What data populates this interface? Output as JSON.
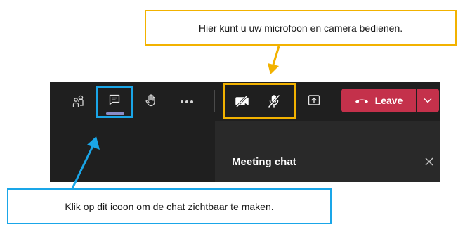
{
  "callouts": {
    "top": "Hier kunt u uw microfoon en camera bedienen.",
    "bottom": "Klik op dit icoon om de chat zichtbaar te maken."
  },
  "toolbar": {
    "buttons": [
      {
        "name": "participants",
        "icon": "people-icon"
      },
      {
        "name": "chat",
        "icon": "chat-icon",
        "active": true
      },
      {
        "name": "raise-hand",
        "icon": "hand-icon"
      },
      {
        "name": "more",
        "icon": "more-icon"
      },
      {
        "name": "camera",
        "icon": "camera-off-icon"
      },
      {
        "name": "microphone",
        "icon": "mic-off-icon"
      },
      {
        "name": "share",
        "icon": "share-icon"
      }
    ],
    "leave_label": "Leave"
  },
  "chat_panel": {
    "title": "Meeting chat"
  },
  "colors": {
    "toolbar_bg": "#1f1f1f",
    "panel_bg": "#292929",
    "leave_red": "#c4314b",
    "highlight_blue": "#1aa6e8",
    "highlight_yellow": "#f2b200",
    "active_underline": "#8b8cc7"
  }
}
